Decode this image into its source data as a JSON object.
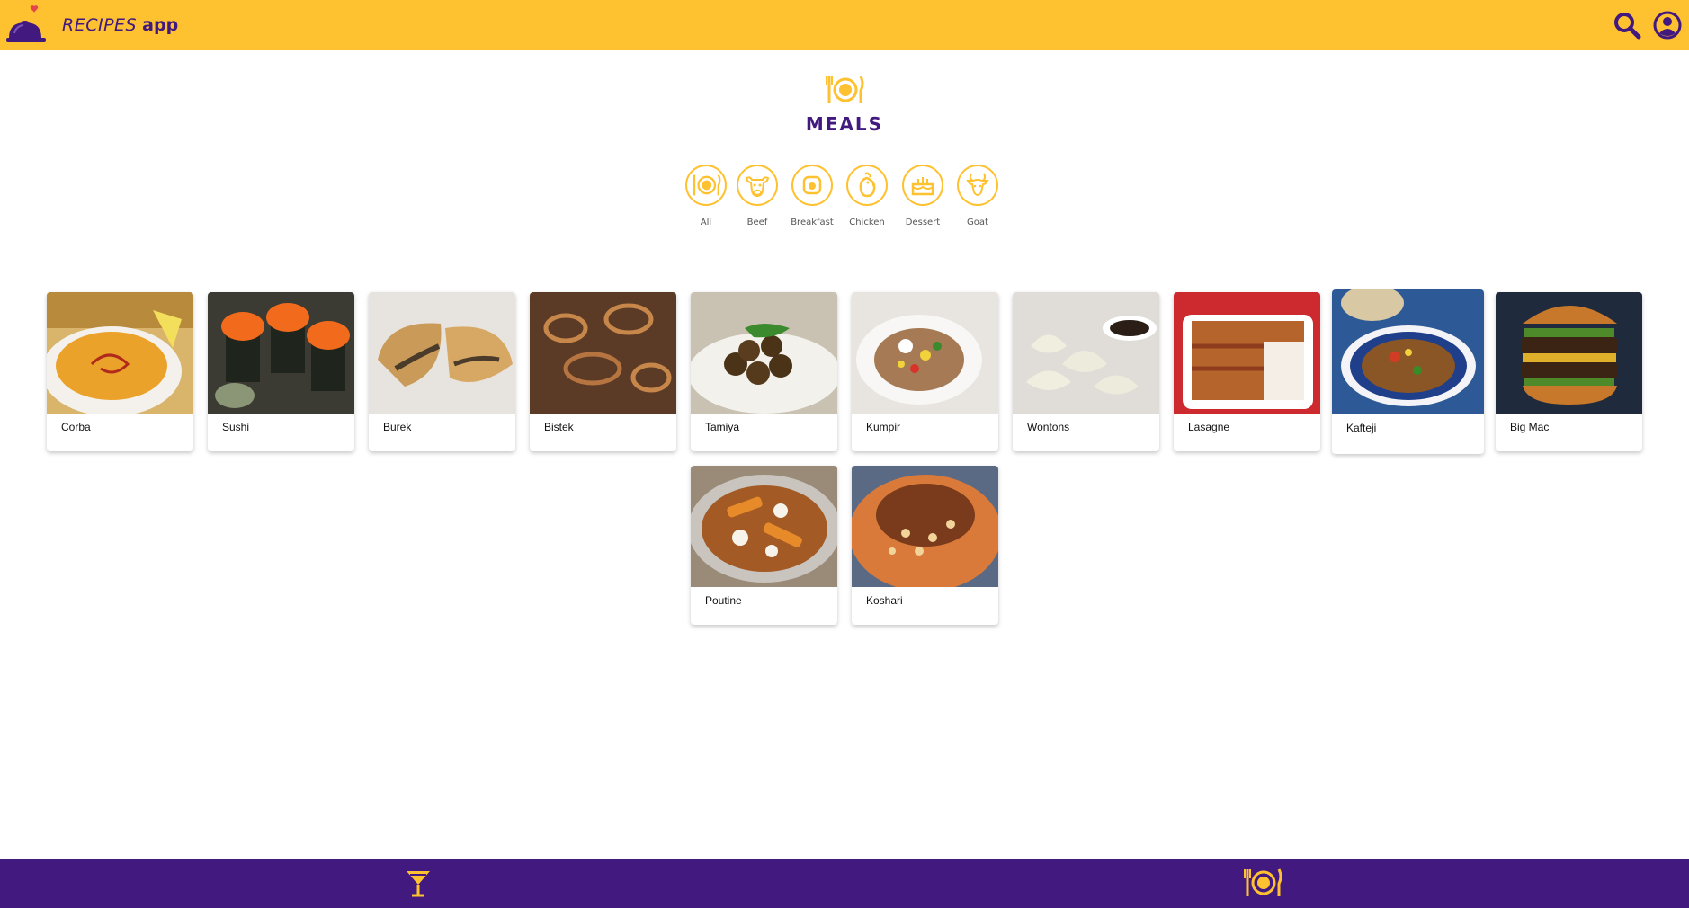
{
  "header": {
    "title_part1": "RECIPES",
    "title_part2": "app",
    "icons": [
      "cloche-heart-logo",
      "search-icon",
      "profile-icon"
    ]
  },
  "page": {
    "icon": "meals-icon",
    "title": "MEALS"
  },
  "categories": [
    {
      "label": "All",
      "icon": "plate-icon"
    },
    {
      "label": "Beef",
      "icon": "cow-icon"
    },
    {
      "label": "Breakfast",
      "icon": "breakfast-icon"
    },
    {
      "label": "Chicken",
      "icon": "chicken-icon"
    },
    {
      "label": "Dessert",
      "icon": "cake-icon"
    },
    {
      "label": "Goat",
      "icon": "goat-icon"
    }
  ],
  "meals": [
    {
      "name": "Corba"
    },
    {
      "name": "Sushi"
    },
    {
      "name": "Burek"
    },
    {
      "name": "Bistek"
    },
    {
      "name": "Tamiya"
    },
    {
      "name": "Kumpir"
    },
    {
      "name": "Wontons"
    },
    {
      "name": "Lasagne"
    },
    {
      "name": "Kafteji"
    },
    {
      "name": "Big Mac"
    },
    {
      "name": "Poutine"
    },
    {
      "name": "Koshari"
    }
  ],
  "bottom_nav": {
    "items": [
      {
        "icon": "cocktail-icon"
      },
      {
        "icon": "meals-icon"
      }
    ]
  },
  "colors": {
    "accent_yellow": "#FEC130",
    "brand_purple": "#41197F"
  }
}
